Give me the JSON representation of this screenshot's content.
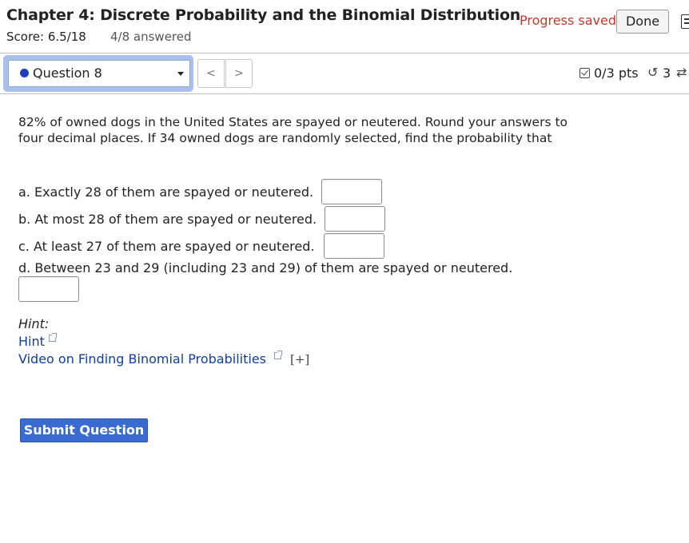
{
  "header": {
    "title": "Chapter 4: Discrete Probability and the Binomial Distribution",
    "score": "Score: 6.5/18",
    "answered": "4/8 answered",
    "progress_status": "Progress saved",
    "done_label": "Done"
  },
  "question_nav": {
    "selected": "Question 8",
    "prev_label": "<",
    "next_label": ">"
  },
  "points": {
    "text": "0/3 pts",
    "attempts": "3",
    "retry_icon": "↺",
    "swap_icon": "⇄"
  },
  "question": {
    "prompt": "82% of owned dogs in the United States are spayed or neutered. Round your answers to four decimal places. If 34 owned dogs are randomly selected, find the probability that",
    "parts": [
      {
        "label": "a. Exactly 28 of them are spayed or neutered.",
        "value": ""
      },
      {
        "label": "b. At most 28 of them are spayed or neutered.",
        "value": ""
      },
      {
        "label": "c. At least 27 of them are spayed or neutered.",
        "value": ""
      },
      {
        "label": "d. Between 23 and 29 (including 23 and 29) of them are spayed or neutered.",
        "value": ""
      }
    ]
  },
  "hints": {
    "heading": "Hint:",
    "hint_link": "Hint",
    "video_link": "Video on Finding Binomial Probabilities",
    "expand_label": "[+]"
  },
  "actions": {
    "submit_label": "Submit Question"
  },
  "colors": {
    "progress_saved": "#c0392b",
    "link": "#123e9c",
    "submit_bg": "#3a6bd0",
    "selector_focus": "#a9c0ee"
  }
}
